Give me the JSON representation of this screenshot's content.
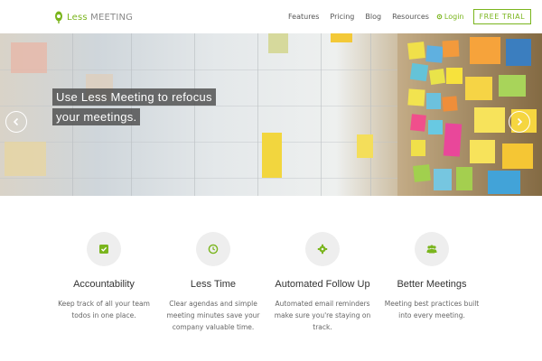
{
  "brand": {
    "name_part1": "Less",
    "name_part2": " MEETING",
    "accent_color": "#7ab51d",
    "logo_icon": "leaf-icon"
  },
  "nav": {
    "items": [
      {
        "label": "Features"
      },
      {
        "label": "Pricing"
      },
      {
        "label": "Blog"
      },
      {
        "label": "Resources"
      }
    ],
    "login_label": "Login",
    "login_icon": "gear-icon",
    "trial_label": "FREE TRIAL"
  },
  "hero": {
    "caption_line1": "Use Less Meeting to refocus",
    "caption_line2": "your meetings.",
    "prev_icon": "chevron-left-icon",
    "next_icon": "chevron-right-icon"
  },
  "features": [
    {
      "icon": "checkbox-icon",
      "title": "Accountability",
      "desc": "Keep track of all your team todos in one place."
    },
    {
      "icon": "clock-icon",
      "title": "Less Time",
      "desc": "Clear agendas and simple meeting minutes save your company valuable time."
    },
    {
      "icon": "gear-icon",
      "title": "Automated Follow Up",
      "desc": "Automated email reminders make sure you're staying on track."
    },
    {
      "icon": "people-icon",
      "title": "Better Meetings",
      "desc": "Meeting best practices built into every meeting."
    }
  ]
}
